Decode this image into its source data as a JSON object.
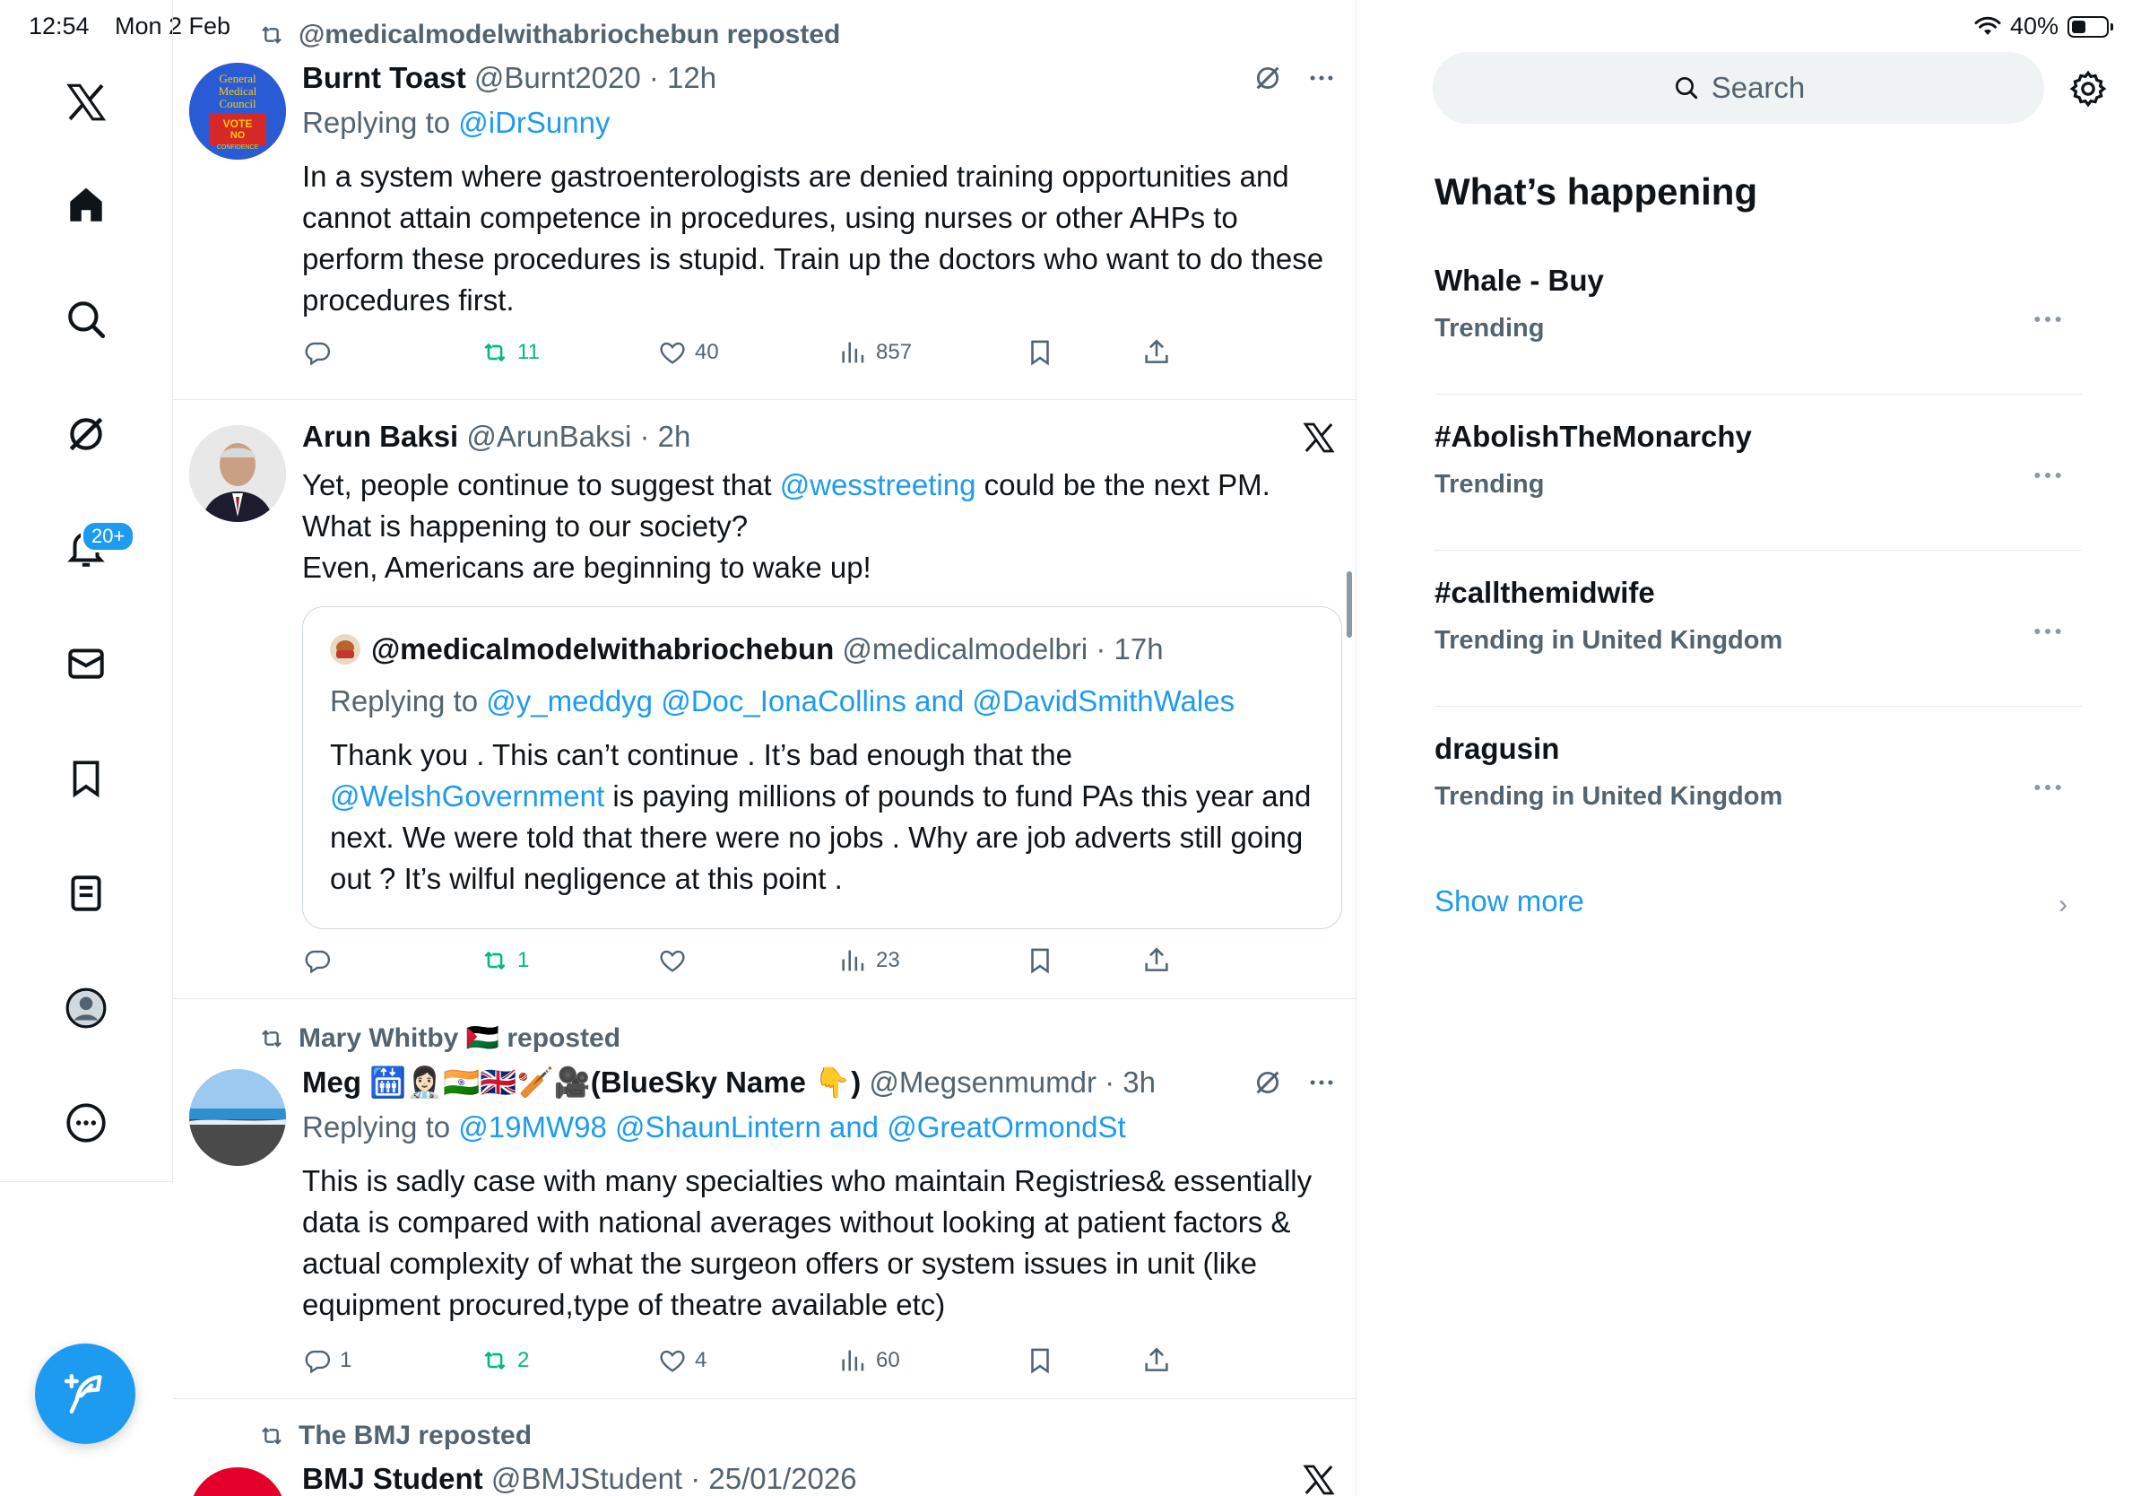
{
  "status": {
    "time": "12:54",
    "date": "Mon 2 Feb",
    "battery": "40%"
  },
  "nav": {
    "notifications_badge": "20+"
  },
  "tweets": [
    {
      "reposted_by": "@medicalmodelwithabriochebun reposted",
      "name": "Burnt Toast",
      "meta": " @Burnt2020 · 12h",
      "replying_prefix": "Replying to ",
      "replying_to": "@iDrSunny",
      "body": "In a system where gastroenterologists are denied training opportunities and cannot attain competence in procedures, using nurses or other AHPs to perform these procedures is stupid. Train up the doctors who want to do these procedures first.",
      "avatar_text": [
        "General",
        "Medical",
        "Council",
        "VOTE",
        "NO",
        "CONFIDENCE"
      ],
      "counts": {
        "replies": "",
        "reposts": "11",
        "likes": "40",
        "views": "857"
      }
    },
    {
      "name": "Arun Baksi",
      "meta": " @ArunBaksi · 2h",
      "body_part1": "Yet, people continue to suggest that ",
      "body_link": "@wesstreeting",
      "body_part2": " could be the next PM.",
      "body_line2": "What is happening to our society?",
      "body_line3": "Even, Americans are beginning to wake up!",
      "quote": {
        "name": "@medicalmodelwithabriochebun",
        "meta": " @medicalmodelbri · 17h",
        "replying_prefix": "Replying to ",
        "replying_to": "@y_meddyg @Doc_IonaCollins and @DavidSmithWales",
        "body_line1": "Thank you . This can’t continue . It’s bad enough that the",
        "body_link": "@WelshGovernment",
        "body_rest": " is paying millions of pounds to fund PAs this year and next. We were told that there were no jobs . Why are job adverts still going out ? It’s wilful negligence at this point ."
      },
      "counts": {
        "replies": "",
        "reposts": "1",
        "likes": "",
        "views": "23"
      }
    },
    {
      "reposted_by": "Mary Whitby 🇵🇸 reposted",
      "name": "Meg 🛗👩🏻‍⚕️🇮🇳🇬🇧🏏🎥(BlueSky Name 👇)",
      "meta": " @Megsenmumdr · 3h",
      "replying_prefix": "Replying to ",
      "replying_to": "@19MW98 @ShaunLintern and @GreatOrmondSt",
      "body": "This is sadly case with many specialties who maintain Registries& essentially data is compared with national averages without looking at patient factors & actual complexity of what the surgeon offers or system issues in unit (like equipment procured,type of theatre available etc)",
      "counts": {
        "replies": "1",
        "reposts": "2",
        "likes": "4",
        "views": "60"
      }
    },
    {
      "reposted_by": "The BMJ reposted",
      "name": "BMJ Student",
      "meta": " @BMJStudent · 25/01/2026"
    }
  ],
  "sidebar": {
    "search_placeholder": "Search",
    "title": "What’s happening",
    "trends": [
      {
        "name": "Whale - Buy",
        "sub": "Trending"
      },
      {
        "name": "#AbolishTheMonarchy",
        "sub": "Trending"
      },
      {
        "name": "#callthemidwife",
        "sub": "Trending in United Kingdom"
      },
      {
        "name": "dragusin",
        "sub": "Trending in United Kingdom"
      }
    ],
    "show_more": "Show more"
  },
  "colors": {
    "accent": "#1d9bf0",
    "repost_green": "#00ba7c",
    "muted": "#536471",
    "border": "#e6e9ec"
  }
}
